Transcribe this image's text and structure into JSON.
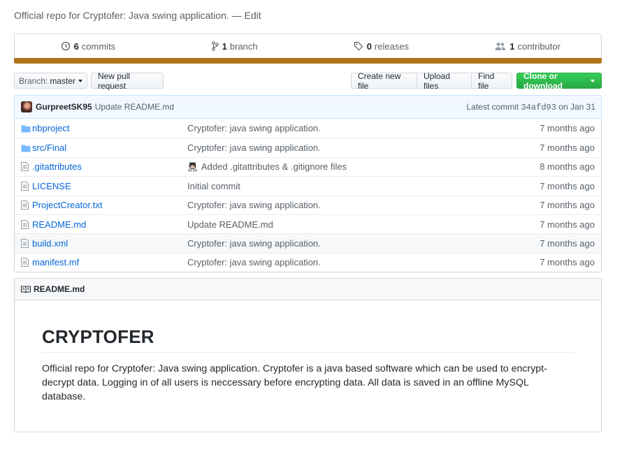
{
  "repo": {
    "description": "Official repo for Cryptofer: Java swing application.",
    "separator": "—",
    "edit_label": "Edit"
  },
  "summary": {
    "commits_count": "6",
    "commits_label": "commits",
    "branches_count": "1",
    "branches_label": "branch",
    "releases_count": "0",
    "releases_label": "releases",
    "contributors_count": "1",
    "contributors_label": "contributor",
    "language_color": "#b07219"
  },
  "toolbar": {
    "branch_prefix": "Branch:",
    "branch_name": "master",
    "new_pr": "New pull request",
    "create_file": "Create new file",
    "upload_files": "Upload files",
    "find_file": "Find file",
    "clone": "Clone or download"
  },
  "latest_commit": {
    "author": "GurpreetSK95",
    "message": "Update README.md",
    "prefix": "Latest commit",
    "sha": "34afd93",
    "date": "on Jan 31"
  },
  "files": [
    {
      "name": "nbproject",
      "type": "folder",
      "message": "Cryptofer: java swing application.",
      "age": "7 months ago"
    },
    {
      "name": "src/Final",
      "type": "folder",
      "message": "Cryptofer: java swing application.",
      "age": "7 months ago"
    },
    {
      "name": ".gitattributes",
      "type": "file",
      "message": "Added .gitattributes & .gitignore files",
      "age": "8 months ago"
    },
    {
      "name": "LICENSE",
      "type": "file",
      "message": "Initial commit",
      "age": "7 months ago"
    },
    {
      "name": "ProjectCreator.txt",
      "type": "file",
      "message": "Cryptofer: java swing application.",
      "age": "7 months ago"
    },
    {
      "name": "README.md",
      "type": "file",
      "message": "Update README.md",
      "age": "7 months ago"
    },
    {
      "name": "build.xml",
      "type": "file",
      "message": "Cryptofer: java swing application.",
      "age": "7 months ago"
    },
    {
      "name": "manifest.mf",
      "type": "file",
      "message": "Cryptofer: java swing application.",
      "age": "7 months ago"
    }
  ],
  "readme": {
    "filename": "README.md",
    "title": "CRYPTOFER",
    "body": "Official repo for Cryptofer: Java swing application. Cryptofer is a java based software which can be used to encrypt-decrypt data. Logging in of all users is neccessary before encrypting data. All data is saved in an offline MySQL database."
  }
}
